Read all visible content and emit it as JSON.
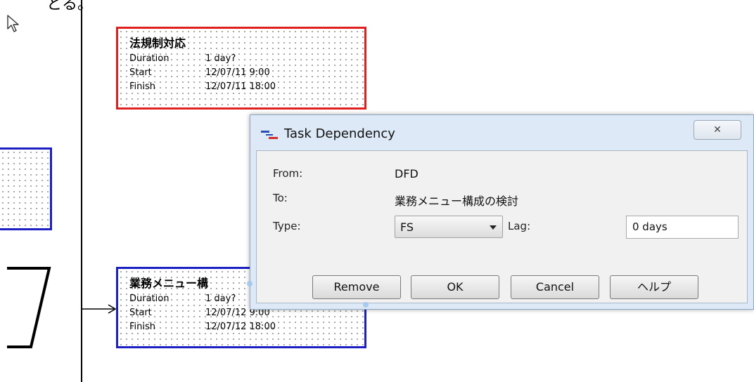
{
  "background": {
    "top_text": "とる。"
  },
  "tasks": [
    {
      "title": "法規制対応",
      "duration_label": "Duration",
      "duration": "1 day?",
      "start_label": "Start",
      "start": "12/07/11 9:00",
      "finish_label": "Finish",
      "finish": "12/07/11 18:00",
      "border_color": "#e01f1f"
    },
    {
      "title": "業務メニュー構",
      "duration_label": "Duration",
      "duration": "1 day?",
      "start_label": "Start",
      "start": "12/07/12 9:00",
      "finish_label": "Finish",
      "finish": "12/07/12 18:00",
      "border_color": "#1c20c2"
    }
  ],
  "dialog": {
    "title": "Task Dependency",
    "close_glyph": "✕",
    "from_label": "From:",
    "from_value": "DFD",
    "to_label": "To:",
    "to_value": "業務メニュー構成の検討",
    "type_label": "Type:",
    "type_value": "FS",
    "lag_label": "Lag:",
    "lag_value": "0 days",
    "buttons": {
      "remove": "Remove",
      "ok": "OK",
      "cancel": "Cancel",
      "help": "ヘルプ"
    }
  },
  "icons": {
    "cursor": "mouse-pointer-icon",
    "dialog_icon": "task-dependency-icon",
    "dropdown": "chevron-down-icon"
  }
}
